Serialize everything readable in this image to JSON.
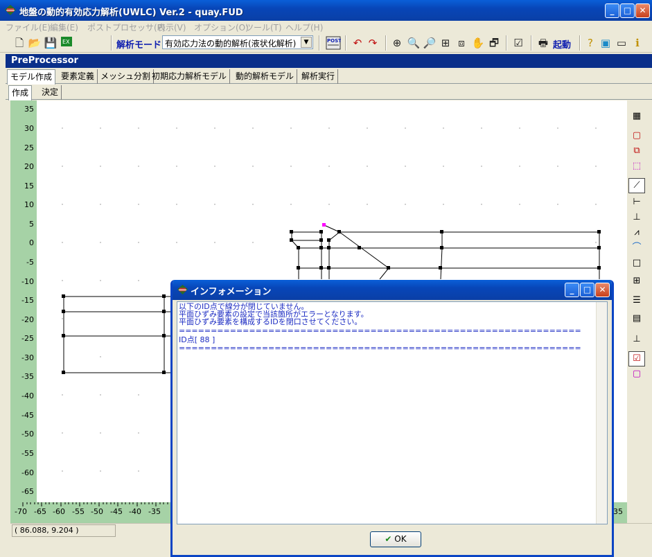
{
  "window": {
    "title": "地盤の動的有効応力解析(UWLC) Ver.2 - quay.FUD"
  },
  "menu": [
    "ファイル(E)",
    "編集(E)",
    "ポストプロセッサ(P)",
    "表示(V)",
    "オプション(O)",
    "ツール(T)",
    "ヘルプ(H)"
  ],
  "toolbar": {
    "mode_label": "解析モード",
    "mode_value": "有効応力法の動的解析(液状化解析)",
    "launch_label": "起動",
    "post_label": "POST"
  },
  "header": {
    "title": "PreProcessor"
  },
  "tabs": [
    "モデル作成",
    "要素定義",
    "メッシュ分割",
    "初期応力解析モデル",
    "動的解析モデル",
    "解析実行"
  ],
  "subtabs": [
    "作成",
    "決定"
  ],
  "y_ticks": [
    "35",
    "30",
    "25",
    "20",
    "15",
    "10",
    "5",
    "0",
    "-5",
    "-10",
    "-15",
    "-20",
    "-25",
    "-30",
    "-35",
    "-40",
    "-45",
    "-50",
    "-55",
    "-60",
    "-65"
  ],
  "x_ticks": [
    "-70",
    "-65",
    "-60",
    "-55",
    "-50",
    "-45",
    "-40",
    "-35"
  ],
  "x_tick_right": "35",
  "status": {
    "coords": "(  86.088,    9.204 )"
  },
  "dialog": {
    "title": "インフォメーション",
    "lines": [
      "以下のID点で線分が閉じていません。",
      "平面ひずみ要素の設定で当該箇所がエラーとなります。",
      "平面ひずみ要素を構成するIDを閉口させてください。",
      "===============================================================",
      "ID点[ 88 ]",
      "==============================================================="
    ],
    "ok_label": "OK"
  },
  "colors": {
    "title_blue": "#0846b8",
    "ruler_green": "#a6d2a6",
    "dialog_text": "#1a2ac2",
    "selected_point": "#ff00ff"
  }
}
